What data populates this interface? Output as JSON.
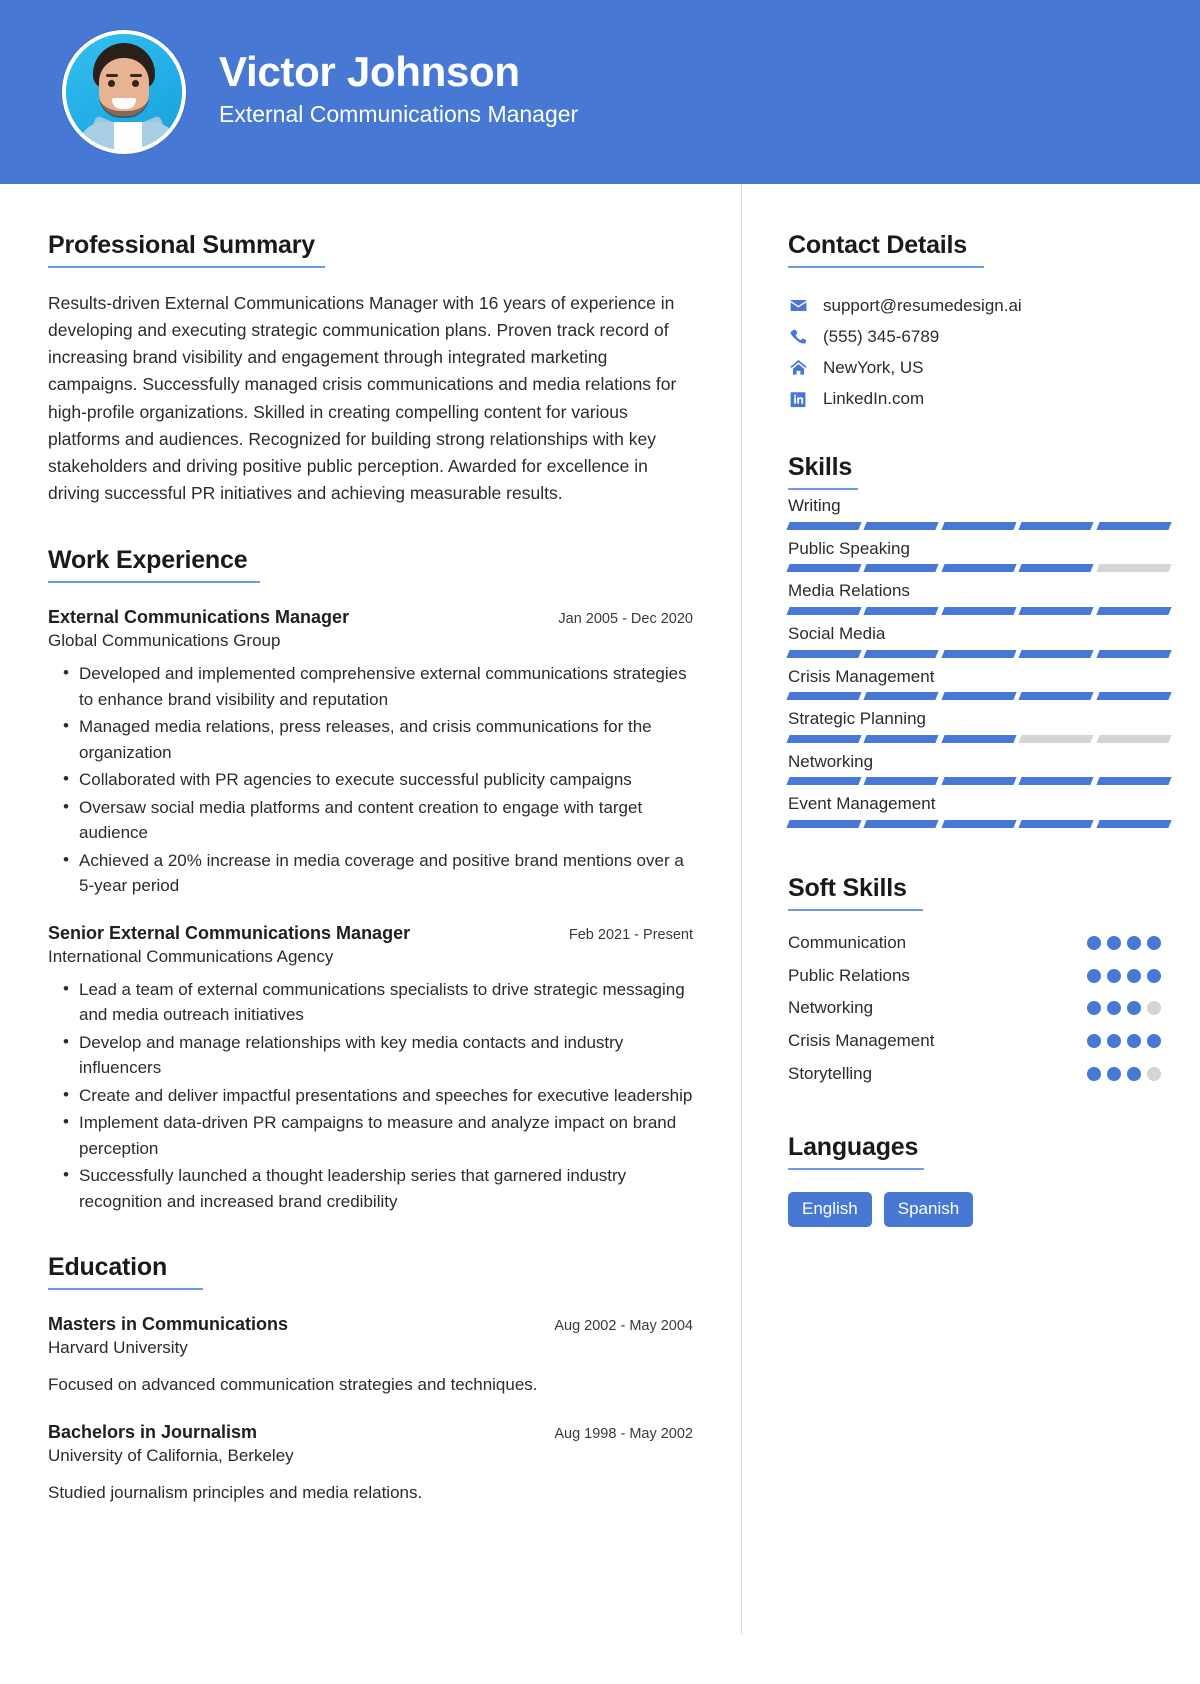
{
  "theme": {
    "accent": "#4778d4",
    "muted": "#d5d5d5",
    "header_bg": "#4778d4",
    "photo_bg": "#2bb6e8"
  },
  "header": {
    "name": "Victor Johnson",
    "role": "External Communications Manager"
  },
  "summary": {
    "heading": "Professional Summary",
    "text": "Results-driven External Communications Manager with 16 years of experience in developing and executing strategic communication plans. Proven track record of increasing brand visibility and engagement through integrated marketing campaigns. Successfully managed crisis communications and media relations for high-profile organizations. Skilled in creating compelling content for various platforms and audiences. Recognized for building strong relationships with key stakeholders and driving positive public perception. Awarded for excellence in driving successful PR initiatives and achieving measurable results."
  },
  "work": {
    "heading": "Work Experience",
    "entries": [
      {
        "title": "External Communications Manager",
        "date": "Jan 2005 - Dec 2020",
        "org": "Global Communications Group",
        "bullets": [
          "Developed and implemented comprehensive external communications strategies to enhance brand visibility and reputation",
          "Managed media relations, press releases, and crisis communications for the organization",
          "Collaborated with PR agencies to execute successful publicity campaigns",
          "Oversaw social media platforms and content creation to engage with target audience",
          "Achieved a 20% increase in media coverage and positive brand mentions over a 5-year period"
        ]
      },
      {
        "title": "Senior External Communications Manager",
        "date": "Feb 2021 - Present",
        "org": "International Communications Agency",
        "bullets": [
          "Lead a team of external communications specialists to drive strategic messaging and media outreach initiatives",
          "Develop and manage relationships with key media contacts and industry influencers",
          "Create and deliver impactful presentations and speeches for executive leadership",
          "Implement data-driven PR campaigns to measure and analyze impact on brand perception",
          "Successfully launched a thought leadership series that garnered industry recognition and increased brand credibility"
        ]
      }
    ]
  },
  "education": {
    "heading": "Education",
    "entries": [
      {
        "title": "Masters in Communications",
        "date": "Aug 2002 - May 2004",
        "org": "Harvard University",
        "desc": "Focused on advanced communication strategies and techniques."
      },
      {
        "title": "Bachelors in Journalism",
        "date": "Aug 1998 - May 2002",
        "org": "University of California, Berkeley",
        "desc": "Studied journalism principles and media relations."
      }
    ]
  },
  "contact": {
    "heading": "Contact Details",
    "items": [
      {
        "icon": "envelope-icon",
        "value": "support@resumedesign.ai"
      },
      {
        "icon": "phone-icon",
        "value": "(555) 345-6789"
      },
      {
        "icon": "home-icon",
        "value": "NewYork, US"
      },
      {
        "icon": "linkedin-icon",
        "value": "LinkedIn.com"
      }
    ]
  },
  "skills": {
    "heading": "Skills",
    "max": 5,
    "items": [
      {
        "name": "Writing",
        "level": 5
      },
      {
        "name": "Public Speaking",
        "level": 4
      },
      {
        "name": "Media Relations",
        "level": 5
      },
      {
        "name": "Social Media",
        "level": 5
      },
      {
        "name": "Crisis Management",
        "level": 5
      },
      {
        "name": "Strategic Planning",
        "level": 3
      },
      {
        "name": "Networking",
        "level": 5
      },
      {
        "name": "Event Management",
        "level": 5
      }
    ]
  },
  "soft_skills": {
    "heading": "Soft Skills",
    "max": 4,
    "items": [
      {
        "name": "Communication",
        "level": 4
      },
      {
        "name": "Public Relations",
        "level": 4
      },
      {
        "name": "Networking",
        "level": 3
      },
      {
        "name": "Crisis Management",
        "level": 4
      },
      {
        "name": "Storytelling",
        "level": 3
      }
    ]
  },
  "languages": {
    "heading": "Languages",
    "items": [
      "English",
      "Spanish"
    ]
  }
}
